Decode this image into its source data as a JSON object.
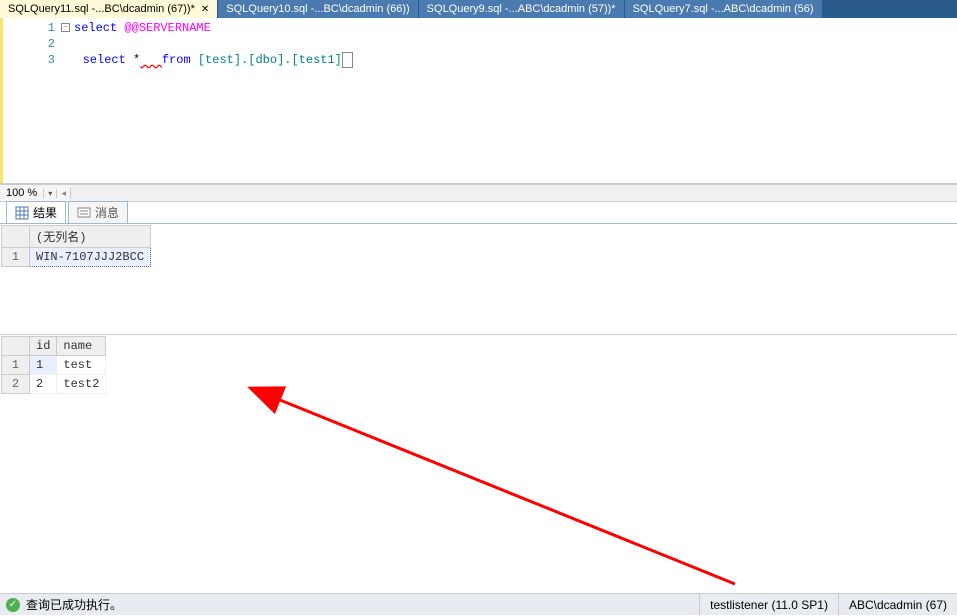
{
  "tabs": [
    {
      "label": "SQLQuery11.sql -...BC\\dcadmin (67))*",
      "active": true
    },
    {
      "label": "SQLQuery10.sql -...BC\\dcadmin (66))",
      "active": false
    },
    {
      "label": "SQLQuery9.sql -...ABC\\dcadmin (57))*",
      "active": false
    },
    {
      "label": "SQLQuery7.sql -...ABC\\dcadmin (56)",
      "active": false
    }
  ],
  "editor": {
    "lines": [
      "1",
      "2",
      "3"
    ],
    "code": {
      "line1": {
        "kw": "select",
        "sys": "@@SERVERNAME"
      },
      "line3": {
        "kw1": "select",
        "star": "*",
        "squig": "   ",
        "kw2": "from",
        "obj": "[test].[dbo].[test1]"
      }
    }
  },
  "zoom": {
    "value": "100 %"
  },
  "result_tabs": {
    "results": "结果",
    "messages": "消息"
  },
  "grid1": {
    "header": "(无列名)",
    "rows": [
      {
        "num": "1",
        "val": "WIN-7107JJJ2BCC"
      }
    ]
  },
  "grid2": {
    "headers": [
      "id",
      "name"
    ],
    "rows": [
      {
        "num": "1",
        "id": "1",
        "name": "test"
      },
      {
        "num": "2",
        "id": "2",
        "name": "test2"
      }
    ]
  },
  "status": {
    "message": "查询已成功执行。",
    "server": "testlistener (11.0 SP1)",
    "user": "ABC\\dcadmin (67)"
  }
}
